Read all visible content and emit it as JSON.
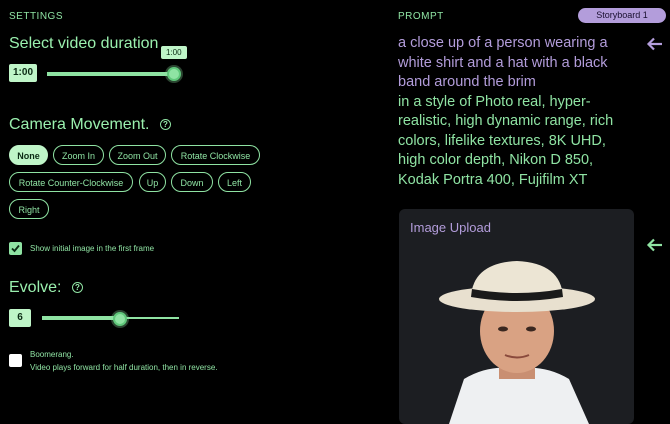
{
  "settings": {
    "section_label": "SETTINGS",
    "duration": {
      "title": "Select video duration",
      "value": "1:00",
      "tooltip": "1:00",
      "fraction": 1.0
    },
    "camera": {
      "title": "Camera Movement.",
      "help_icon": "?",
      "options": [
        {
          "label": "None",
          "active": true
        },
        {
          "label": "Zoom In",
          "active": false
        },
        {
          "label": "Zoom Out",
          "active": false
        },
        {
          "label": "Rotate Clockwise",
          "active": false
        },
        {
          "label": "Rotate Counter-Clockwise",
          "active": false
        },
        {
          "label": "Up",
          "active": false
        },
        {
          "label": "Down",
          "active": false
        },
        {
          "label": "Left",
          "active": false
        },
        {
          "label": "Right",
          "active": false
        }
      ]
    },
    "show_initial": {
      "checked": true,
      "label": "Show initial image in the first frame"
    },
    "evolve": {
      "title": "Evolve:",
      "help_icon": "?",
      "value": "6",
      "fraction": 0.55
    },
    "boomerang": {
      "checked": false,
      "label": "Boomerang.",
      "description": "Video plays forward for half duration, then in reverse."
    }
  },
  "prompt": {
    "section_label": "PROMPT",
    "storyboard_label": "Storyboard 1",
    "subject_lines": [
      "a close up of a person wearing a",
      "white shirt and a hat with a black",
      "band around the brim"
    ],
    "style_lines": [
      "in a style of Photo real, hyper-",
      "realistic, high dynamic range, rich",
      "colors, lifelike textures, 8K UHD,",
      "high color depth, Nikon D 850,",
      "Kodak Portra 400, Fujifilm XT"
    ],
    "arrow_icon": "←"
  },
  "image_upload": {
    "title": "Image Upload",
    "arrow_icon": "←"
  },
  "colors": {
    "accent_green": "#8fe3a3",
    "accent_purple": "#b39ddb",
    "background": "#000000",
    "card": "#1c1e22"
  }
}
